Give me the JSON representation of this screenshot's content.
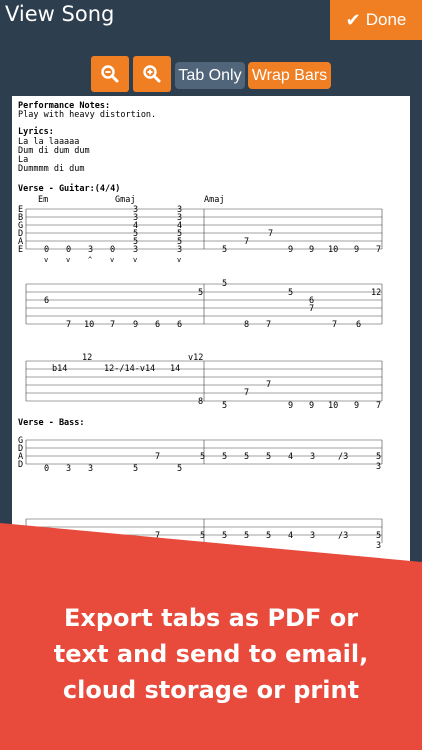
{
  "header": {
    "title": "View Song",
    "done_label": "Done"
  },
  "toolbar": {
    "zoom_out_icon": "zoom-out-icon",
    "zoom_in_icon": "zoom-in-icon",
    "tab_only_label": "Tab Only",
    "wrap_bars_label": "Wrap Bars"
  },
  "song": {
    "perf_heading": "Performance Notes:",
    "perf_text": "Play with heavy distortion.",
    "lyrics_heading": "Lyrics:",
    "lyrics": [
      "La la laaaaa",
      "Dum di dum dum",
      "La",
      "Dummmm di dum"
    ],
    "verse_guitar_heading": "Verse - Guitar:(4/4)",
    "verse_bass_heading": "Verse - Bass:",
    "chords": [
      "Em",
      "Gmaj",
      "Amaj"
    ],
    "string_names_guitar": [
      "E",
      "B",
      "G",
      "D",
      "A",
      "E"
    ],
    "string_names_bass": [
      "G",
      "D",
      "A",
      "D"
    ],
    "staff1_notes": [
      "3",
      "3",
      "3",
      "3",
      "4",
      "4",
      "5",
      "5",
      "5",
      "5",
      "7",
      "0",
      "0",
      "3",
      "0",
      "3",
      "3",
      "5",
      "9",
      "9",
      "10",
      "9",
      "7"
    ],
    "staff1_strokes": [
      "v",
      "v",
      "^",
      "v",
      "v",
      "v"
    ],
    "staff2_notes": [
      "5",
      "5",
      "5",
      "12",
      "6",
      "6",
      "7",
      "7",
      "10",
      "7",
      "9",
      "9",
      "6",
      "8",
      "8",
      "7",
      "6"
    ],
    "staff3_notes": [
      "12",
      "v12",
      "b14",
      "12-/14-v14",
      "14",
      "7",
      "7",
      "8",
      "5",
      "9",
      "9",
      "10",
      "9",
      "7"
    ],
    "bass_notes": [
      "7",
      "5",
      "5",
      "5",
      "5",
      "4",
      "3",
      "/3",
      "5",
      "3",
      "0",
      "3",
      "3",
      "5",
      "5"
    ],
    "bass2_notes": [
      "7",
      "5",
      "5",
      "5",
      "5",
      "4",
      "3",
      "/3",
      "5",
      "3"
    ]
  },
  "promo": {
    "lines": [
      "Export tabs as PDF or",
      "text and send to email,",
      "cloud storage or print"
    ]
  },
  "colors": {
    "accent": "#f07f23",
    "bar_bg": "#2d3e4f",
    "pill_bg": "#50647a",
    "banner": "#e84a3b"
  }
}
